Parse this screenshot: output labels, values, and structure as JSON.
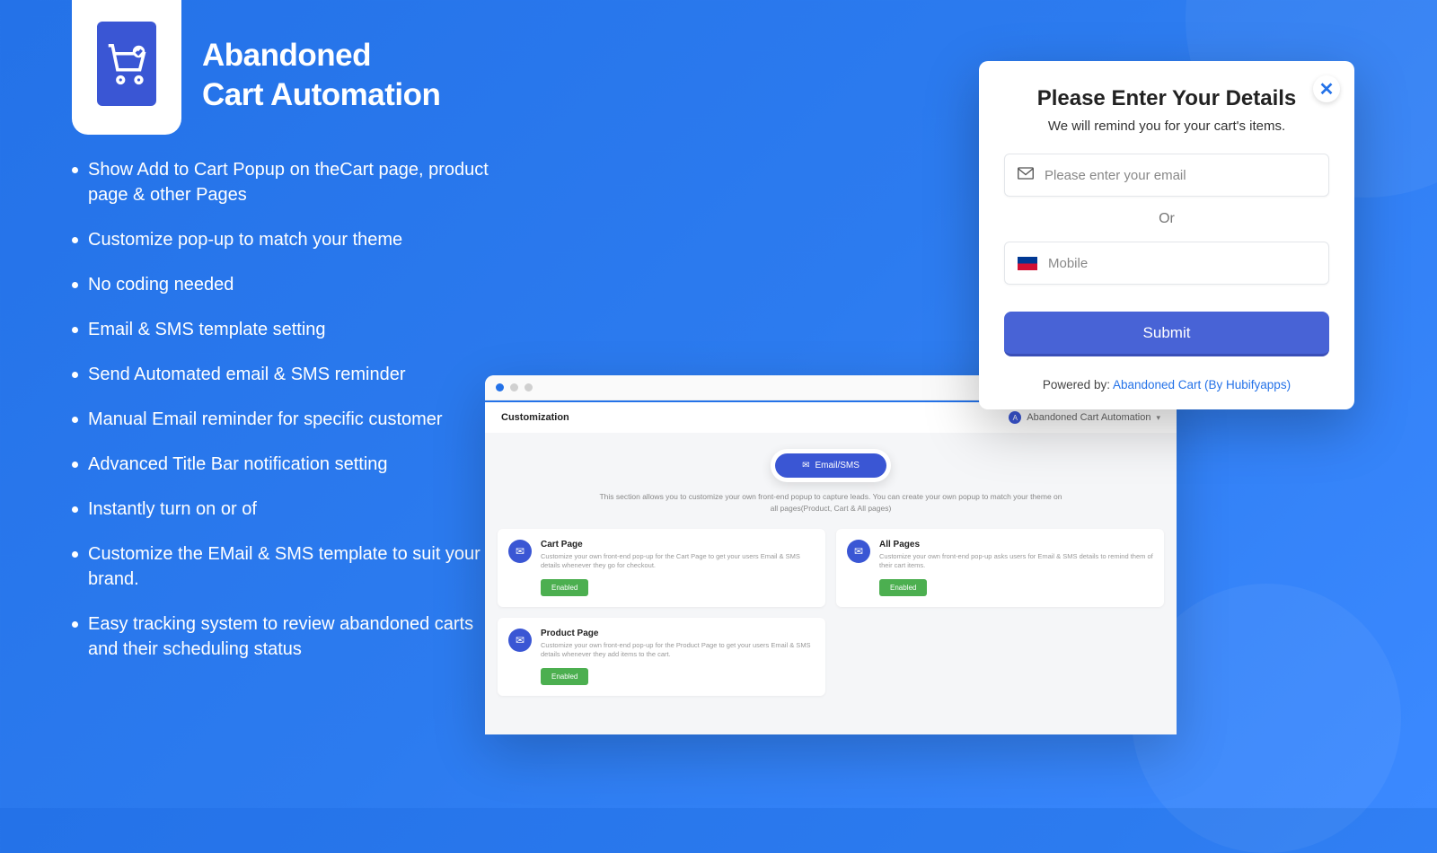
{
  "title_line1": "Abandoned",
  "title_line2": "Cart Automation",
  "features": [
    "Show Add to Cart Popup on theCart page, product page & other Pages",
    "Customize pop-up to match your theme",
    "No coding needed",
    "Email & SMS template setting",
    "Send Automated email & SMS reminder",
    "Manual Email reminder for specific customer",
    "Advanced Title Bar notification setting",
    "Instantly turn on or of",
    "Customize the EMail & SMS template to suit your brand.",
    "Easy tracking system to review abandoned carts and their scheduling status"
  ],
  "popup": {
    "heading": "Please Enter Your Details",
    "subheading": "We will remind you for your cart's items.",
    "email_placeholder": "Please enter your email",
    "or": "Or",
    "mobile_placeholder": "Mobile",
    "submit": "Submit",
    "powered_prefix": "Powered by: ",
    "powered_link": "Abandoned Cart (By Hubifyapps)"
  },
  "dashboard": {
    "header_left": "Customization",
    "header_right": "Abandoned Cart Automation",
    "tab_label": "Email/SMS",
    "description": "This section allows you to customize your own front-end popup to capture leads. You can create your own popup to match your theme on all pages(Product, Cart & All pages)",
    "cards": [
      {
        "title": "Cart Page",
        "desc": "Customize your own front-end pop-up for the Cart Page to get your users Email & SMS details whenever they go for checkout.",
        "status": "Enabled"
      },
      {
        "title": "All Pages",
        "desc": "Customize your own front-end pop-up asks users for Email & SMS details to remind them of their cart items.",
        "status": "Enabled"
      },
      {
        "title": "Product Page",
        "desc": "Customize your own front-end pop-up for the Product Page to get your users Email & SMS details whenever they add items to the cart.",
        "status": "Enabled"
      }
    ]
  }
}
